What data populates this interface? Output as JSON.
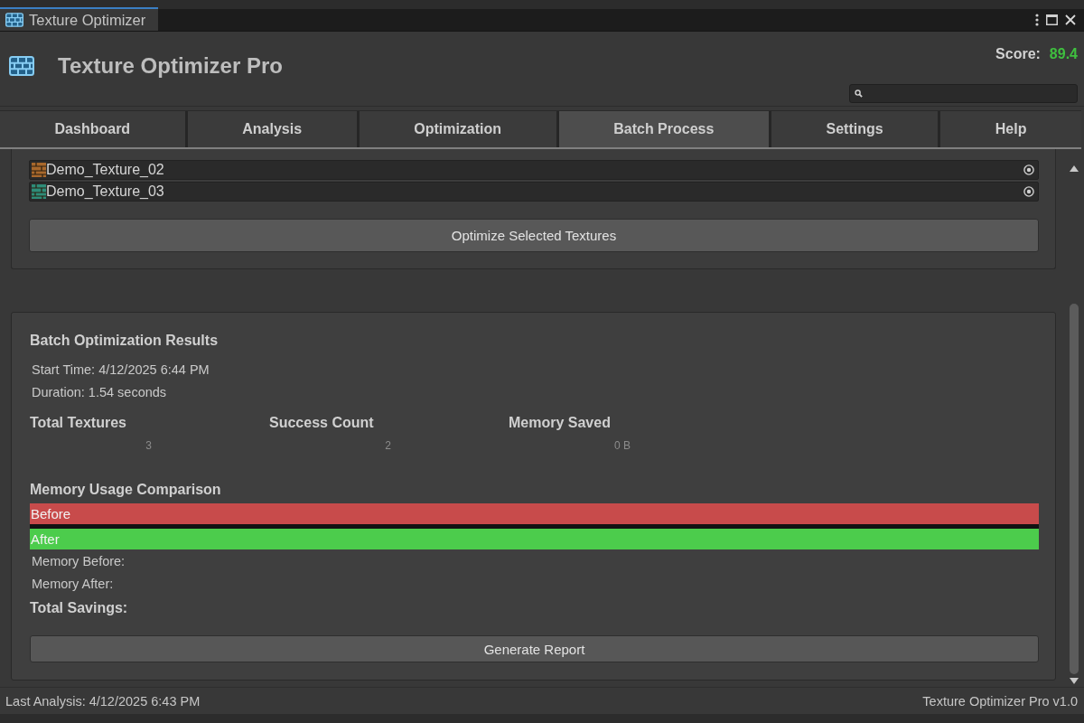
{
  "window": {
    "tab_title": "Texture Optimizer"
  },
  "header": {
    "title": "Texture Optimizer Pro",
    "score_label": "Score:",
    "score_value": "89.4"
  },
  "tabs": [
    {
      "label": "Dashboard",
      "selected": false
    },
    {
      "label": "Analysis",
      "selected": false
    },
    {
      "label": "Optimization",
      "selected": false
    },
    {
      "label": "Batch Process",
      "selected": true
    },
    {
      "label": "Settings",
      "selected": false
    },
    {
      "label": "Help",
      "selected": false
    }
  ],
  "texture_list": {
    "items": [
      {
        "name": "Demo_Texture_02",
        "color": "#a8682c"
      },
      {
        "name": "Demo_Texture_03",
        "color": "#2e8c78"
      }
    ],
    "optimize_button": "Optimize Selected Textures"
  },
  "results": {
    "title": "Batch Optimization Results",
    "start_time": "Start Time: 4/12/2025 6:44 PM",
    "duration": "Duration: 1.54 seconds",
    "stats": [
      {
        "label": "Total Textures",
        "value": "3"
      },
      {
        "label": "Success Count",
        "value": "2"
      },
      {
        "label": "Memory Saved",
        "value": "0 B"
      }
    ],
    "comparison": {
      "title": "Memory Usage Comparison",
      "bars": [
        {
          "label": "Before",
          "level": 1,
          "color": "#c84b4b"
        },
        {
          "label": "After",
          "level": 1,
          "color": "#4ccc4c"
        }
      ]
    },
    "memory_before": "Memory Before:",
    "memory_after": "Memory After:",
    "total_savings": "Total Savings:",
    "report_button": "Generate Report"
  },
  "status_bar": {
    "last_analysis": "Last Analysis: 4/12/2025 6:43 PM",
    "version": "Texture Optimizer Pro v1.0"
  }
}
